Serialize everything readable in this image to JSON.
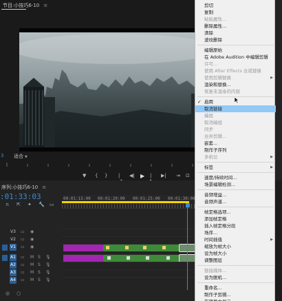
{
  "monitor": {
    "title": "节目:小技巧6-10",
    "menu_icon": "≡",
    "timecode": "3",
    "fit_label": "适合",
    "fit_caret": "▼",
    "transport": [
      "▼",
      "{",
      "}",
      "|◀",
      "◀|",
      "▶",
      "|▶",
      "▶|",
      "⇥",
      "⊡"
    ]
  },
  "timeline": {
    "title": "序列:小技巧6-10",
    "menu_icon": "≡",
    "timecode": ":01:33:03",
    "tools": [
      "∩",
      "⇱",
      "✦",
      "🔧",
      "▭"
    ],
    "ruler_labels": [
      "00:01:15:00",
      "00:01:20:00",
      "00:01:25:00",
      "00:01:30:00"
    ],
    "tracks": [
      {
        "name": "V3",
        "ic1": "▭",
        "ic2": "◉",
        "src": false,
        "active": false
      },
      {
        "name": "V2",
        "ic1": "▭",
        "ic2": "◉",
        "src": false,
        "active": false
      },
      {
        "name": "V1",
        "ic1": "▭",
        "ic2": "◉",
        "src": true,
        "active": true
      },
      {
        "name": "A1",
        "ic1": "▭",
        "ic2": "M",
        "ic3": "S",
        "ic4": "🎙",
        "src": true,
        "active": true
      },
      {
        "name": "A2",
        "ic1": "▭",
        "ic2": "M",
        "ic3": "S",
        "ic4": "🎙",
        "src": false,
        "active": true
      },
      {
        "name": "A3",
        "ic1": "▭",
        "ic2": "M",
        "ic3": "S",
        "ic4": "🎙",
        "src": false,
        "active": true
      },
      {
        "name": "A4",
        "ic1": "▭",
        "ic2": "M",
        "ic3": "S",
        "ic4": "🎙",
        "src": false,
        "active": true
      }
    ],
    "bottom_icons": [
      "◎",
      "○"
    ]
  },
  "context_menu": {
    "items": [
      {
        "label": "剪切",
        "disabled": false
      },
      {
        "label": "复制",
        "disabled": false
      },
      {
        "label": "粘贴属性...",
        "disabled": true
      },
      {
        "label": "删除属性...",
        "disabled": false
      },
      {
        "label": "清除",
        "disabled": false
      },
      {
        "label": "波纹删除",
        "disabled": false
      },
      {
        "sep": true
      },
      {
        "label": "编辑原始",
        "disabled": false
      },
      {
        "label": "在 Adobe Audition 中编辑剪辑",
        "disabled": false
      },
      {
        "label": "许可...",
        "disabled": true
      },
      {
        "label": "使用 After Effects 合成替换",
        "disabled": true
      },
      {
        "label": "使用剪辑替换",
        "disabled": true,
        "submenu": true
      },
      {
        "label": "渲染和替换...",
        "disabled": false
      },
      {
        "label": "恢复未渲染的内容",
        "disabled": true
      },
      {
        "sep": true
      },
      {
        "label": "启用",
        "disabled": false,
        "checked": true
      },
      {
        "label": "取消链接",
        "disabled": false,
        "highlight": true
      },
      {
        "label": "编组",
        "disabled": true
      },
      {
        "label": "取消编组",
        "disabled": true
      },
      {
        "label": "同步",
        "disabled": true
      },
      {
        "label": "合并剪辑...",
        "disabled": true
      },
      {
        "label": "嵌套...",
        "disabled": false
      },
      {
        "label": "制作子序列",
        "disabled": false
      },
      {
        "label": "多机位",
        "disabled": true,
        "submenu": true
      },
      {
        "sep": true
      },
      {
        "label": "标签",
        "disabled": false,
        "submenu": true
      },
      {
        "sep": true
      },
      {
        "label": "速度/持续时间...",
        "disabled": false
      },
      {
        "label": "场景编辑检测...",
        "disabled": false
      },
      {
        "sep": true
      },
      {
        "label": "音频增益...",
        "disabled": false
      },
      {
        "label": "音频声道...",
        "disabled": false
      },
      {
        "sep": true
      },
      {
        "label": "帧定格选项...",
        "disabled": false
      },
      {
        "label": "添加帧定格",
        "disabled": false
      },
      {
        "label": "插入帧定格分段",
        "disabled": false
      },
      {
        "label": "场序...",
        "disabled": false
      },
      {
        "label": "时间插值",
        "disabled": false,
        "submenu": true
      },
      {
        "label": "缩放为帧大小",
        "disabled": false
      },
      {
        "label": "设为帧大小",
        "disabled": false
      },
      {
        "label": "调整图层",
        "disabled": false
      },
      {
        "sep": true
      },
      {
        "label": "链接媒体...",
        "disabled": true
      },
      {
        "label": "设为脱机...",
        "disabled": false
      },
      {
        "sep": true
      },
      {
        "label": "重命名...",
        "disabled": false
      },
      {
        "label": "制作子剪辑...",
        "disabled": false
      },
      {
        "label": "在项目中显示",
        "disabled": false
      },
      {
        "label": "在资源管理器中显示...",
        "disabled": false
      }
    ]
  }
}
